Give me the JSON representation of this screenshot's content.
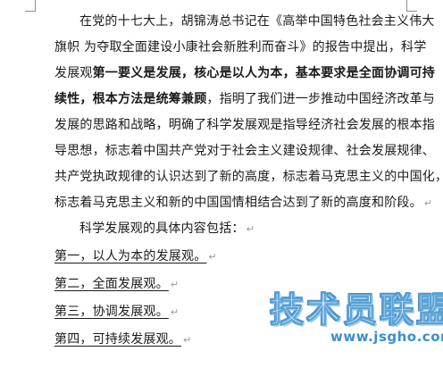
{
  "document": {
    "para1": {
      "line1": "在党的十七大上，胡锦涛总书记在《高举中国特色社会主义伟大",
      "line2": "旗帜  为夺取全面建设小康社会新胜利而奋斗》的报告中提出，科学",
      "line3_normal_a": "发展观",
      "line3_bold": "第一要义是发展，核心是以人为本，基本要求是全面协调可持",
      "line4_bold": "续性，根本方法是统筹兼顾",
      "line4_normal": "，指明了我们进一步推动中国经济改革与",
      "line5": "发展的思路和战略，明确了科学发展观是指导经济社会发展的根本指",
      "line6": "导思想，标志着中国共产党对于社会主义建设规律、社会发展规律、",
      "line7": "共产党执政规律的认识达到了新的高度，标志着马克思主义的中国化，",
      "line8": "标志着马克思主义和新的中国国情相结合达到了新的高度和阶段。"
    },
    "para2": "科学发展观的具体内容包括：",
    "items": [
      "第一，以人为本的发展观。",
      "第二，全面发展观。",
      "第三，协调发展观。",
      "第四，可持续发展观。"
    ],
    "paragraph_mark": "↵"
  },
  "watermark": {
    "title": "技术员联盟",
    "url": "www.jsgho.com",
    "color": "#3a8fd0"
  }
}
